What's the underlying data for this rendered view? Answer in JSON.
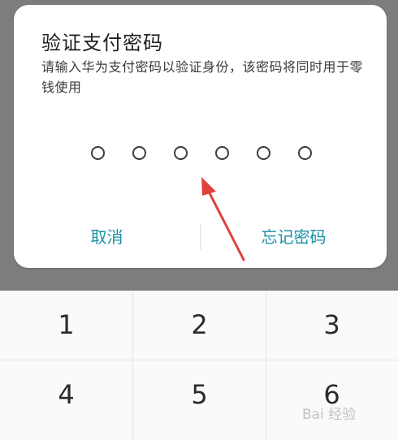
{
  "dialog": {
    "title": "验证支付密码",
    "description": "请输入华为支付密码以验证身份，该密码将同时用于零钱使用",
    "pin_length": 6,
    "cancel_label": "取消",
    "forgot_label": "忘记密码"
  },
  "keypad": {
    "keys": [
      "1",
      "2",
      "3",
      "4",
      "5",
      "6"
    ]
  },
  "colors": {
    "accent": "#1a8fa5",
    "arrow": "#e0413a",
    "overlay": "#7d7d7d"
  },
  "watermark": "Bai 经验"
}
